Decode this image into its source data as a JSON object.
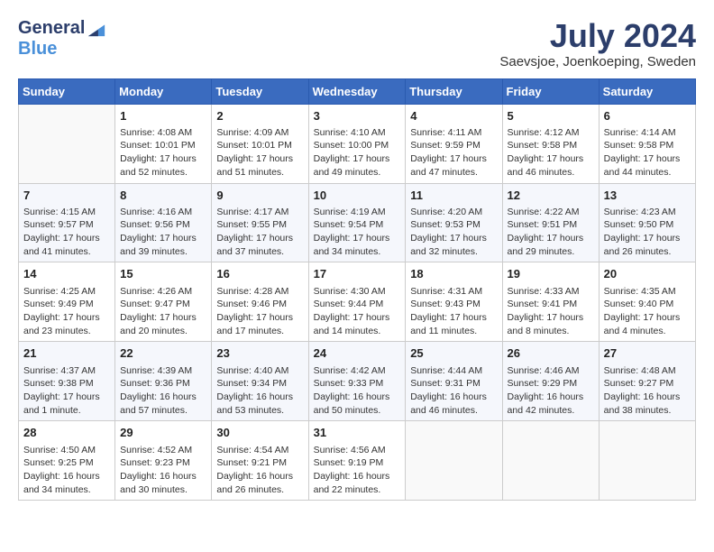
{
  "logo": {
    "general": "General",
    "blue": "Blue"
  },
  "header": {
    "month_title": "July 2024",
    "location": "Saevsjoe, Joenkoeping, Sweden"
  },
  "weekdays": [
    "Sunday",
    "Monday",
    "Tuesday",
    "Wednesday",
    "Thursday",
    "Friday",
    "Saturday"
  ],
  "weeks": [
    [
      {
        "day": "",
        "info": ""
      },
      {
        "day": "1",
        "info": "Sunrise: 4:08 AM\nSunset: 10:01 PM\nDaylight: 17 hours and 52 minutes."
      },
      {
        "day": "2",
        "info": "Sunrise: 4:09 AM\nSunset: 10:01 PM\nDaylight: 17 hours and 51 minutes."
      },
      {
        "day": "3",
        "info": "Sunrise: 4:10 AM\nSunset: 10:00 PM\nDaylight: 17 hours and 49 minutes."
      },
      {
        "day": "4",
        "info": "Sunrise: 4:11 AM\nSunset: 9:59 PM\nDaylight: 17 hours and 47 minutes."
      },
      {
        "day": "5",
        "info": "Sunrise: 4:12 AM\nSunset: 9:58 PM\nDaylight: 17 hours and 46 minutes."
      },
      {
        "day": "6",
        "info": "Sunrise: 4:14 AM\nSunset: 9:58 PM\nDaylight: 17 hours and 44 minutes."
      }
    ],
    [
      {
        "day": "7",
        "info": "Sunrise: 4:15 AM\nSunset: 9:57 PM\nDaylight: 17 hours and 41 minutes."
      },
      {
        "day": "8",
        "info": "Sunrise: 4:16 AM\nSunset: 9:56 PM\nDaylight: 17 hours and 39 minutes."
      },
      {
        "day": "9",
        "info": "Sunrise: 4:17 AM\nSunset: 9:55 PM\nDaylight: 17 hours and 37 minutes."
      },
      {
        "day": "10",
        "info": "Sunrise: 4:19 AM\nSunset: 9:54 PM\nDaylight: 17 hours and 34 minutes."
      },
      {
        "day": "11",
        "info": "Sunrise: 4:20 AM\nSunset: 9:53 PM\nDaylight: 17 hours and 32 minutes."
      },
      {
        "day": "12",
        "info": "Sunrise: 4:22 AM\nSunset: 9:51 PM\nDaylight: 17 hours and 29 minutes."
      },
      {
        "day": "13",
        "info": "Sunrise: 4:23 AM\nSunset: 9:50 PM\nDaylight: 17 hours and 26 minutes."
      }
    ],
    [
      {
        "day": "14",
        "info": "Sunrise: 4:25 AM\nSunset: 9:49 PM\nDaylight: 17 hours and 23 minutes."
      },
      {
        "day": "15",
        "info": "Sunrise: 4:26 AM\nSunset: 9:47 PM\nDaylight: 17 hours and 20 minutes."
      },
      {
        "day": "16",
        "info": "Sunrise: 4:28 AM\nSunset: 9:46 PM\nDaylight: 17 hours and 17 minutes."
      },
      {
        "day": "17",
        "info": "Sunrise: 4:30 AM\nSunset: 9:44 PM\nDaylight: 17 hours and 14 minutes."
      },
      {
        "day": "18",
        "info": "Sunrise: 4:31 AM\nSunset: 9:43 PM\nDaylight: 17 hours and 11 minutes."
      },
      {
        "day": "19",
        "info": "Sunrise: 4:33 AM\nSunset: 9:41 PM\nDaylight: 17 hours and 8 minutes."
      },
      {
        "day": "20",
        "info": "Sunrise: 4:35 AM\nSunset: 9:40 PM\nDaylight: 17 hours and 4 minutes."
      }
    ],
    [
      {
        "day": "21",
        "info": "Sunrise: 4:37 AM\nSunset: 9:38 PM\nDaylight: 17 hours and 1 minute."
      },
      {
        "day": "22",
        "info": "Sunrise: 4:39 AM\nSunset: 9:36 PM\nDaylight: 16 hours and 57 minutes."
      },
      {
        "day": "23",
        "info": "Sunrise: 4:40 AM\nSunset: 9:34 PM\nDaylight: 16 hours and 53 minutes."
      },
      {
        "day": "24",
        "info": "Sunrise: 4:42 AM\nSunset: 9:33 PM\nDaylight: 16 hours and 50 minutes."
      },
      {
        "day": "25",
        "info": "Sunrise: 4:44 AM\nSunset: 9:31 PM\nDaylight: 16 hours and 46 minutes."
      },
      {
        "day": "26",
        "info": "Sunrise: 4:46 AM\nSunset: 9:29 PM\nDaylight: 16 hours and 42 minutes."
      },
      {
        "day": "27",
        "info": "Sunrise: 4:48 AM\nSunset: 9:27 PM\nDaylight: 16 hours and 38 minutes."
      }
    ],
    [
      {
        "day": "28",
        "info": "Sunrise: 4:50 AM\nSunset: 9:25 PM\nDaylight: 16 hours and 34 minutes."
      },
      {
        "day": "29",
        "info": "Sunrise: 4:52 AM\nSunset: 9:23 PM\nDaylight: 16 hours and 30 minutes."
      },
      {
        "day": "30",
        "info": "Sunrise: 4:54 AM\nSunset: 9:21 PM\nDaylight: 16 hours and 26 minutes."
      },
      {
        "day": "31",
        "info": "Sunrise: 4:56 AM\nSunset: 9:19 PM\nDaylight: 16 hours and 22 minutes."
      },
      {
        "day": "",
        "info": ""
      },
      {
        "day": "",
        "info": ""
      },
      {
        "day": "",
        "info": ""
      }
    ]
  ]
}
